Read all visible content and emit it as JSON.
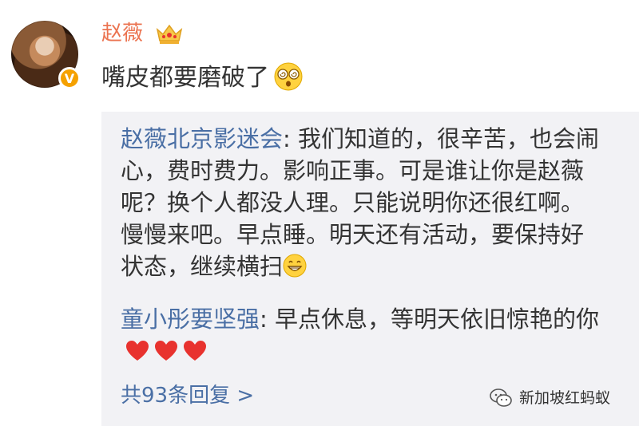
{
  "post": {
    "username": "赵薇",
    "text": "嘴皮都要磨破了",
    "verified_badge": "V",
    "emoji": "dizzy-face-icon",
    "crown": "crown-icon"
  },
  "replies": [
    {
      "author": "赵薇北京影迷会",
      "separator": ": ",
      "text": "我们知道的，很辛苦，也会闹心，费时费力。影响正事。可是谁让你是赵薇呢？换个人都没人理。只能说明你还很红啊。慢慢来吧。早点睡。明天还有活动，要保持好状态，继续横扫"
    },
    {
      "author": "童小彤要坚强",
      "separator": ": ",
      "text": "早点休息，等明天依旧惊艳的你"
    }
  ],
  "more_replies_label": "共93条回复 >",
  "watermark": "新加坡红蚂蚁",
  "colors": {
    "username": "#eb7350",
    "link": "#4a6fa5",
    "text": "#333333",
    "reply_bg": "#f2f2f5",
    "heart": "#e8322e",
    "badge": "#f5a100"
  }
}
